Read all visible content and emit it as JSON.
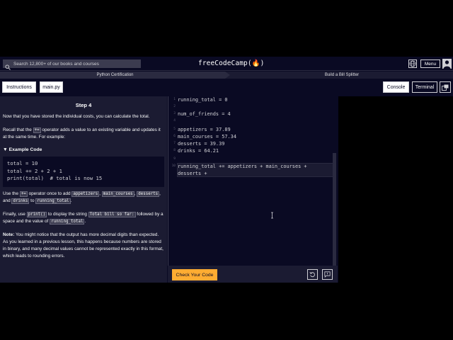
{
  "navbar": {
    "search_placeholder": "Search 12,800+ of our books and courses",
    "brand": "freeCodeCamp(🔥)",
    "menu_label": "Menu"
  },
  "breadcrumb": {
    "course": "Python Certification",
    "project": "Build a Bill Splitter"
  },
  "tabs": {
    "instructions": "Instructions",
    "file": "main.py",
    "console": "Console",
    "terminal": "Terminal"
  },
  "instructions": {
    "step": "Step 4",
    "p1": "Now that you have stored the individual costs, you can calculate the total.",
    "p2_a": "Recall that the ",
    "p2_op": "+=",
    "p2_b": " operator adds a value to an existing variable and updates it at the same time. For example:",
    "summary": "▼ Example Code",
    "example": [
      "total = 10",
      "total += 2 + 2 + 1",
      "print(total)  # total is now 15"
    ],
    "p3_a": "Use the ",
    "p3_op": "+=",
    "p3_b": " operator once to add ",
    "p3_c1": "appetizers",
    "p3_sep1": ", ",
    "p3_c2": "main_courses",
    "p3_sep2": ",",
    "p3_c3": "desserts",
    "p3_and": ", and ",
    "p3_c4": "drinks",
    "p3_to": " to ",
    "p3_c5": "running_total",
    "p3_end": ".",
    "p4_a": "Finally, use ",
    "p4_c1": "print()",
    "p4_b": " to display the string ",
    "p4_c2": "Total bill so far:",
    "p4_c": " followed by a space and the value of ",
    "p4_c3": "running_total",
    "p4_end": ".",
    "note_label": "Note:",
    "note": " You might notice that the output has more decimal digits than expected. As you learned in a previous lesson, this happens because numbers are stored in binary, and many decimal values cannot be represented exactly in this format, which leads to rounding errors."
  },
  "editor": {
    "lines": [
      {
        "n": "1",
        "text": "running_total = 0"
      },
      {
        "n": "2",
        "text": ""
      },
      {
        "n": "3",
        "text": "num_of_friends = 4"
      },
      {
        "n": "4",
        "text": ""
      },
      {
        "n": "5",
        "text": "appetizers = 37.89"
      },
      {
        "n": "6",
        "text": "main_courses = 57.34"
      },
      {
        "n": "7",
        "text": "desserts = 39.39"
      },
      {
        "n": "8",
        "text": "drinks = 64.21"
      },
      {
        "n": "9",
        "text": ""
      },
      {
        "n": "10",
        "text": "running_total += appetizers + main_courses +"
      },
      {
        "n": "",
        "text": "desserts + "
      }
    ],
    "check_label": "Check Your Code"
  }
}
